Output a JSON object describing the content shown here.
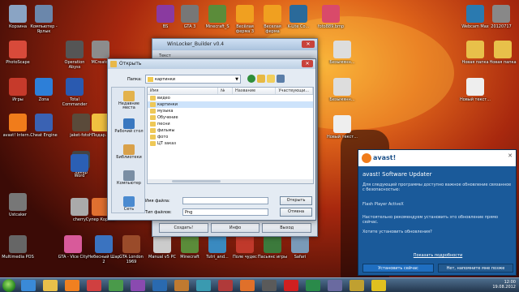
{
  "desktop": {
    "icons": [
      {
        "label": "Корзина",
        "color": "#8aa4c4"
      },
      {
        "label": "Компьютер - Ярлык",
        "color": "#6b87ab"
      },
      {
        "label": "PhotoScape",
        "color": "#d84a3a"
      },
      {
        "label": "Игры",
        "color": "#c63a2b"
      },
      {
        "label": "avast! Intern...",
        "color": "#f07c1b"
      },
      {
        "label": "Zona",
        "color": "#2d7fd8"
      },
      {
        "label": "Cheat Engine",
        "color": "#3a62b3"
      },
      {
        "label": "jaket-fotoH",
        "color": "#5a4a3a"
      },
      {
        "label": "Хакер",
        "color": "#444"
      },
      {
        "label": "Word",
        "color": "#2b5fb4"
      },
      {
        "label": "Ustcaker",
        "color": "#777"
      },
      {
        "label": "cherry",
        "color": "#aaa"
      },
      {
        "label": "Multimedia POS",
        "color": "#666"
      },
      {
        "label": "GTA - Vice City",
        "color": "#d85a9a"
      },
      {
        "label": "Небесный Шар 2",
        "color": "#3a73c0"
      },
      {
        "label": "GTA London 1969",
        "color": "#9a4b2a"
      },
      {
        "label": "Manual v5 PC",
        "color": "#ccc"
      },
      {
        "label": "Minecraft",
        "color": "#5b8c3a"
      },
      {
        "label": "Tutri_and...",
        "color": "#3a8ac0"
      },
      {
        "label": "Поле чудес",
        "color": "#c0392b"
      },
      {
        "label": "Пасьянс игры",
        "color": "#3c7a3c"
      },
      {
        "label": "Safari",
        "color": "#7a9ab8"
      },
      {
        "label": "MCreator",
        "color": "#8c8c8c"
      },
      {
        "label": "Operation Abyss",
        "color": "#555"
      },
      {
        "label": "Total Commander",
        "color": "#2a5ab0"
      },
      {
        "label": "Подар...",
        "color": "#f0c040"
      },
      {
        "label": "Супер Корова",
        "color": "#e07030"
      },
      {
        "label": "BS",
        "color": "#8a3aa0"
      },
      {
        "label": "GTA 3",
        "color": "#777"
      },
      {
        "label": "Minecraft_S",
        "color": "#5b8c3a"
      },
      {
        "label": "Весёлая ферма 3",
        "color": "#f0a020"
      },
      {
        "label": "Веселая ферма",
        "color": "#f0a020"
      },
      {
        "label": "K-Lite Co...",
        "color": "#2a6a9a"
      },
      {
        "label": "foto889.bmp",
        "color": "#d94a6a"
      },
      {
        "label": "Webcam Max",
        "color": "#2a7ab0"
      },
      {
        "label": "20120717",
        "color": "#888"
      },
      {
        "label": "Безымянн...",
        "color": "#ddd"
      },
      {
        "label": "Безымянн...",
        "color": "#ddd"
      },
      {
        "label": "Новый текст...",
        "color": "#eee"
      },
      {
        "label": "Новая папка",
        "color": "#e8c04a"
      },
      {
        "label": "Новая папка",
        "color": "#e8c04a"
      },
      {
        "label": "Новый текст...",
        "color": "#eee"
      }
    ]
  },
  "winlocker": {
    "title": "WinLocker_Builder v0.4",
    "tab": "Текст",
    "buttons": [
      "Создать!",
      "Инфо",
      "Выход"
    ]
  },
  "open_dialog": {
    "title": "Открыть",
    "lookin_label": "Папка:",
    "lookin_value": "картинки",
    "places": [
      {
        "label": "Недавние места",
        "color": "#e3b24c"
      },
      {
        "label": "Рабочий стол",
        "color": "#3a78c0"
      },
      {
        "label": "Библиотеки",
        "color": "#d9a14a"
      },
      {
        "label": "Компьютер",
        "color": "#7a8ea4"
      },
      {
        "label": "Сеть",
        "color": "#4a8ad0"
      }
    ],
    "columns": [
      "Имя",
      "№",
      "Название",
      "Участвующи..."
    ],
    "files": [
      "видео",
      "картинки",
      "музыка",
      "Обучение",
      "песни",
      "фильмы",
      "фото",
      "ЦТ заказ"
    ],
    "filename_label": "Имя файла:",
    "filename_value": "",
    "filetype_label": "Тип файлов:",
    "filetype_value": "Png",
    "open_button": "Открыть",
    "cancel_button": "Отмена"
  },
  "avast": {
    "brand": "avast!",
    "title": "avast! Software Updater",
    "text1": "Для следующей программы доступно важное обновление связанное с безопасностью:",
    "program": "Flash Player ActiveX",
    "text2": "Настоятельно рекомендуем установить это обновление прямо сейчас.",
    "question": "Хотите установить обновления?",
    "details_link": "Показать подробности",
    "install_button": "Установить сейчас",
    "later_button": "Нет, напомните мне позже"
  },
  "taskbar": {
    "time": "12:00",
    "date": "19.08.2012",
    "pinned": [
      {
        "name": "ie-icon",
        "color": "#3a8ad8"
      },
      {
        "name": "explorer-icon",
        "color": "#e8c04a"
      },
      {
        "name": "media-player-icon",
        "color": "#f08020"
      },
      {
        "name": "app-icon",
        "color": "#d04040"
      },
      {
        "name": "app-icon",
        "color": "#4a9a4a"
      },
      {
        "name": "app-icon",
        "color": "#8a4ab0"
      },
      {
        "name": "app-icon",
        "color": "#2a6ab0"
      },
      {
        "name": "app-icon",
        "color": "#c07a30"
      },
      {
        "name": "app-icon",
        "color": "#3a9ab0"
      },
      {
        "name": "app-icon",
        "color": "#b03a3a"
      },
      {
        "name": "firefox-icon",
        "color": "#e0702a"
      },
      {
        "name": "app-icon",
        "color": "#5a5a5a"
      },
      {
        "name": "opera-icon",
        "color": "#d02020"
      },
      {
        "name": "app-icon",
        "color": "#2a8a4a"
      },
      {
        "name": "app-icon",
        "color": "#6a6aa0"
      },
      {
        "name": "app-icon",
        "color": "#c0a030"
      },
      {
        "name": "radiation-icon",
        "color": "#e0c020"
      }
    ]
  }
}
